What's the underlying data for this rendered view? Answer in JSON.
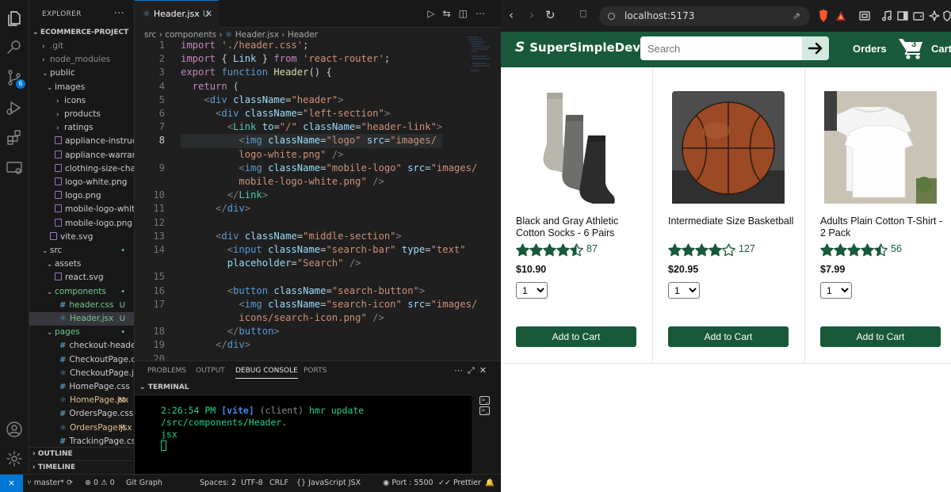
{
  "vscode": {
    "explorer": {
      "title": "EXPLORER",
      "more": "···",
      "project": "ECOMMERCE-PROJECT",
      "items": [
        {
          "label": ".git",
          "chevron": "›",
          "status": ""
        },
        {
          "label": "node_modules",
          "chevron": "›",
          "status": ""
        },
        {
          "label": "public",
          "chevron": "⌄",
          "status": ""
        },
        {
          "label": "images",
          "chevron": "⌄",
          "status": ""
        },
        {
          "label": "icons",
          "chevron": "›",
          "status": ""
        },
        {
          "label": "products",
          "chevron": "›",
          "status": ""
        },
        {
          "label": "ratings",
          "chevron": "›",
          "status": ""
        },
        {
          "label": "appliance-instructi...",
          "chevron": "",
          "status": ""
        },
        {
          "label": "appliance-warrant...",
          "chevron": "",
          "status": ""
        },
        {
          "label": "clothing-size-chart...",
          "chevron": "",
          "status": ""
        },
        {
          "label": "logo-white.png",
          "chevron": "",
          "status": ""
        },
        {
          "label": "logo.png",
          "chevron": "",
          "status": ""
        },
        {
          "label": "mobile-logo-white...",
          "chevron": "",
          "status": ""
        },
        {
          "label": "mobile-logo.png",
          "chevron": "",
          "status": ""
        },
        {
          "label": "vite.svg",
          "chevron": "",
          "status": ""
        },
        {
          "label": "src",
          "chevron": "⌄",
          "status": "•"
        },
        {
          "label": "assets",
          "chevron": "⌄",
          "status": ""
        },
        {
          "label": "react.svg",
          "chevron": "",
          "status": ""
        },
        {
          "label": "components",
          "chevron": "⌄",
          "status": "•"
        },
        {
          "label": "header.css",
          "chevron": "",
          "status": "U"
        },
        {
          "label": "Header.jsx",
          "chevron": "",
          "status": "U"
        },
        {
          "label": "pages",
          "chevron": "⌄",
          "status": "•"
        },
        {
          "label": "checkout-header.css",
          "chevron": "",
          "status": ""
        },
        {
          "label": "CheckoutPage.css",
          "chevron": "",
          "status": ""
        },
        {
          "label": "CheckoutPage.jsx",
          "chevron": "",
          "status": ""
        },
        {
          "label": "HomePage.css",
          "chevron": "",
          "status": ""
        },
        {
          "label": "HomePage.jsx",
          "chevron": "",
          "status": "M"
        },
        {
          "label": "OrdersPage.css",
          "chevron": "",
          "status": ""
        },
        {
          "label": "OrdersPage.jsx",
          "chevron": "",
          "status": "M"
        },
        {
          "label": "TrackingPage.css",
          "chevron": "",
          "status": ""
        }
      ],
      "sections": [
        "OUTLINE",
        "TIMELINE"
      ]
    },
    "tab": {
      "label": "Header.jsx",
      "status": "U"
    },
    "breadcrumb": [
      "src",
      "components",
      "Header.jsx",
      "Header"
    ],
    "line_numbers": [
      "1",
      "2",
      "3",
      "4",
      "5",
      "6",
      "7",
      "8",
      "",
      "9",
      "",
      "10",
      "11",
      "12",
      "13",
      "14",
      "",
      "15",
      "16",
      "17",
      "",
      "18",
      "19",
      "20"
    ],
    "panel": {
      "tabs": [
        "PROBLEMS",
        "OUTPUT",
        "DEBUG CONSOLE",
        "PORTS"
      ],
      "active_tab": "DEBUG CONSOLE",
      "terminal_title": "TERMINAL",
      "log_time": "2:26:54 PM",
      "log_tag": "[vite]",
      "log_source": "(client)",
      "log_msg": "hmr update /src/components/Header.",
      "log_msg2": "jsx"
    },
    "status_bar": {
      "branch": "master*",
      "errors": "0",
      "warnings": "0",
      "git_graph": "Git Graph",
      "spaces": "Spaces: 2",
      "encoding": "UTF-8",
      "eol": "CRLF",
      "language": "JavaScript JSX",
      "port": "Port : 5500",
      "prettier": "Prettier"
    },
    "activity_badge": "6"
  },
  "browser": {
    "url": "localhost:5173",
    "site": {
      "logo": "SuperSimpleDev",
      "search_placeholder": "Search",
      "orders": "Orders",
      "cart_count": "3",
      "cart_label": "Cart",
      "products": [
        {
          "name": "Black and Gray Athletic Cotton Socks - 6 Pairs",
          "rating": 4.5,
          "rating_count": "87",
          "price": "$10.90",
          "qty": "1",
          "add": "Add to Cart"
        },
        {
          "name": "Intermediate Size Basketball",
          "rating": 4.0,
          "rating_count": "127",
          "price": "$20.95",
          "qty": "1",
          "add": "Add to Cart"
        },
        {
          "name": "Adults Plain Cotton T-Shirt - 2 Pack",
          "rating": 4.5,
          "rating_count": "56",
          "price": "$7.99",
          "qty": "1",
          "add": "Add to Cart"
        }
      ]
    }
  },
  "colors": {
    "brand_green": "#19593b",
    "vscode_blue": "#0078d4",
    "star": "#19593b"
  }
}
